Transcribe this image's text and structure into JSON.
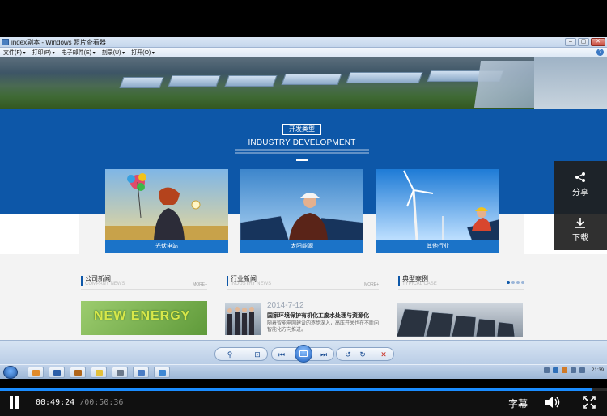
{
  "window": {
    "title": "index副本 - Windows 照片查看器",
    "menu": [
      "文件(F)",
      "打印(P)",
      "电子邮件(E)",
      "刻录(U)",
      "打开(O)"
    ]
  },
  "site": {
    "section_tag": "开发类型",
    "section_heading": "INDUSTRY DEVELOPMENT",
    "cards": [
      {
        "label": "光伏电站"
      },
      {
        "label": "太阳能源"
      },
      {
        "label": "其他行业"
      }
    ],
    "news": [
      {
        "title": "公司新闻",
        "subtitle": "COMPANY NEWS",
        "more": "MORE+"
      },
      {
        "title": "行业新闻",
        "subtitle": "INDUSTRY NEWS",
        "more": "MORE+"
      },
      {
        "title": "典型案例",
        "subtitle": "TYPICAL CASE",
        "more": ""
      }
    ],
    "energy_banner": "NEW ENERGY",
    "article": {
      "date": "2014-7-12",
      "headline": "国家环境保护有机化工废水处理与资源化",
      "summary": "随着智能电网建设的逐步深入，高压开关也在不断向智能化方向推进。"
    }
  },
  "taskbar": {
    "clock": "21:39"
  },
  "side_panel": {
    "share_label": "分享",
    "download_label": "下载"
  },
  "player": {
    "current_time": "00:49:24",
    "separator": "/",
    "duration": "00:50:36",
    "subtitle_label": "字幕",
    "progress_fraction": 0.976
  },
  "colors": {
    "site_blue": "#0d57a8",
    "player_accent": "#1a8cff"
  }
}
